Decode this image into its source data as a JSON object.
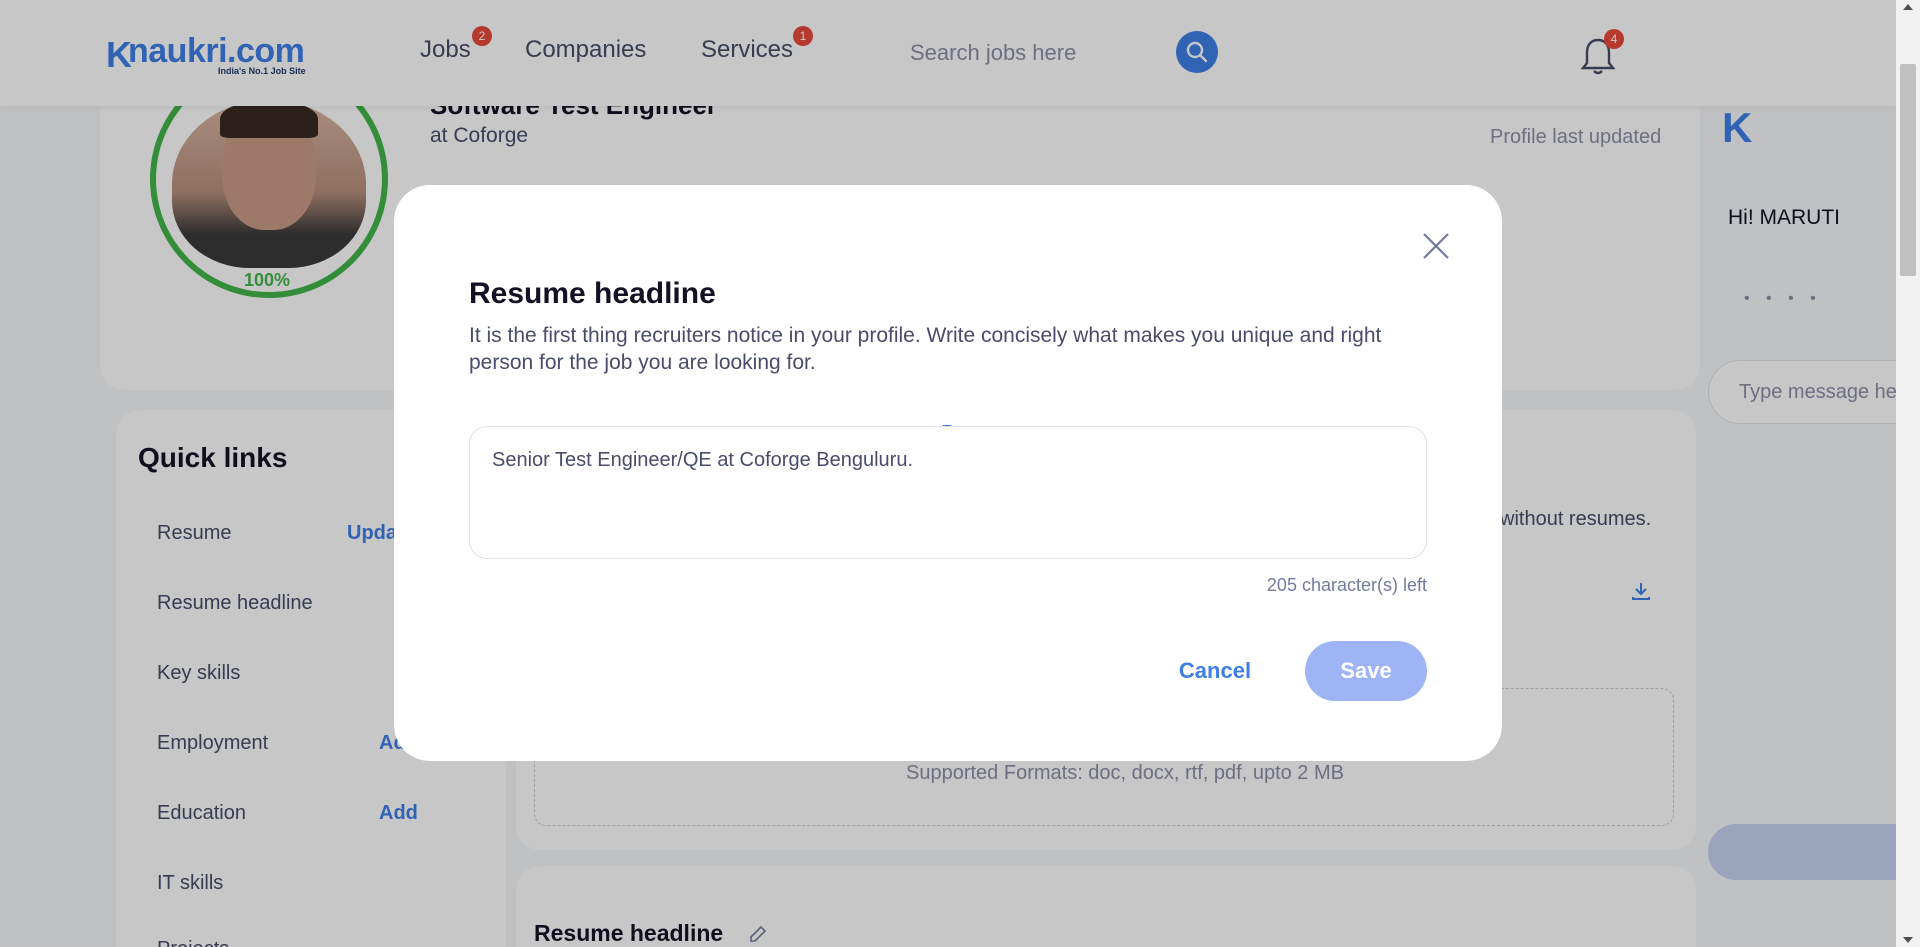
{
  "header": {
    "logo_mark": "K",
    "logo_text": "naukri.com",
    "logo_tagline": "India's No.1 Job Site",
    "nav": [
      {
        "label": "Jobs",
        "badge": "2"
      },
      {
        "label": "Companies",
        "badge": ""
      },
      {
        "label": "Services",
        "badge": "1"
      }
    ],
    "search_placeholder": "Search jobs here",
    "notifications_badge": "4"
  },
  "profile": {
    "role": "Software Test Engineer",
    "company": "at Coforge",
    "completion": "100%",
    "last_updated": "Profile last updated"
  },
  "sidebar_right": {
    "greeting": "Hi! MARUTI",
    "dots": "• • • •",
    "message_placeholder": "Type message here"
  },
  "quick_links": {
    "title": "Quick links",
    "items": [
      {
        "label": "Resume",
        "action": "Update"
      },
      {
        "label": "Resume headline",
        "action": ""
      },
      {
        "label": "Key skills",
        "action": ""
      },
      {
        "label": "Employment",
        "action": "Add"
      },
      {
        "label": "Education",
        "action": "Add"
      },
      {
        "label": "IT skills",
        "action": ""
      },
      {
        "label": "Projects",
        "action": ""
      }
    ]
  },
  "main": {
    "resume_note": "without resumes.",
    "supported_formats": "Supported Formats: doc, docx, rtf, pdf, upto 2 MB",
    "resume_headline_section": "Resume headline"
  },
  "modal": {
    "title": "Resume headline",
    "description": "It is the first thing recruiters notice in your profile. Write concisely what makes you unique and right person for the job you are looking for.",
    "textarea_value": "Senior Test Engineer/QE at Coforge Benguluru.",
    "chars_left": "205 character(s) left",
    "cancel_label": "Cancel",
    "save_label": "Save"
  },
  "colors": {
    "accent": "#3e7fe6",
    "save_button": "#9eb4f5",
    "badge": "#e84a3a",
    "progress": "#43b54a"
  },
  "icons": {
    "close": "close-icon",
    "search": "search-icon",
    "bell": "bell-icon",
    "download": "download-icon",
    "edit": "pencil-icon"
  }
}
